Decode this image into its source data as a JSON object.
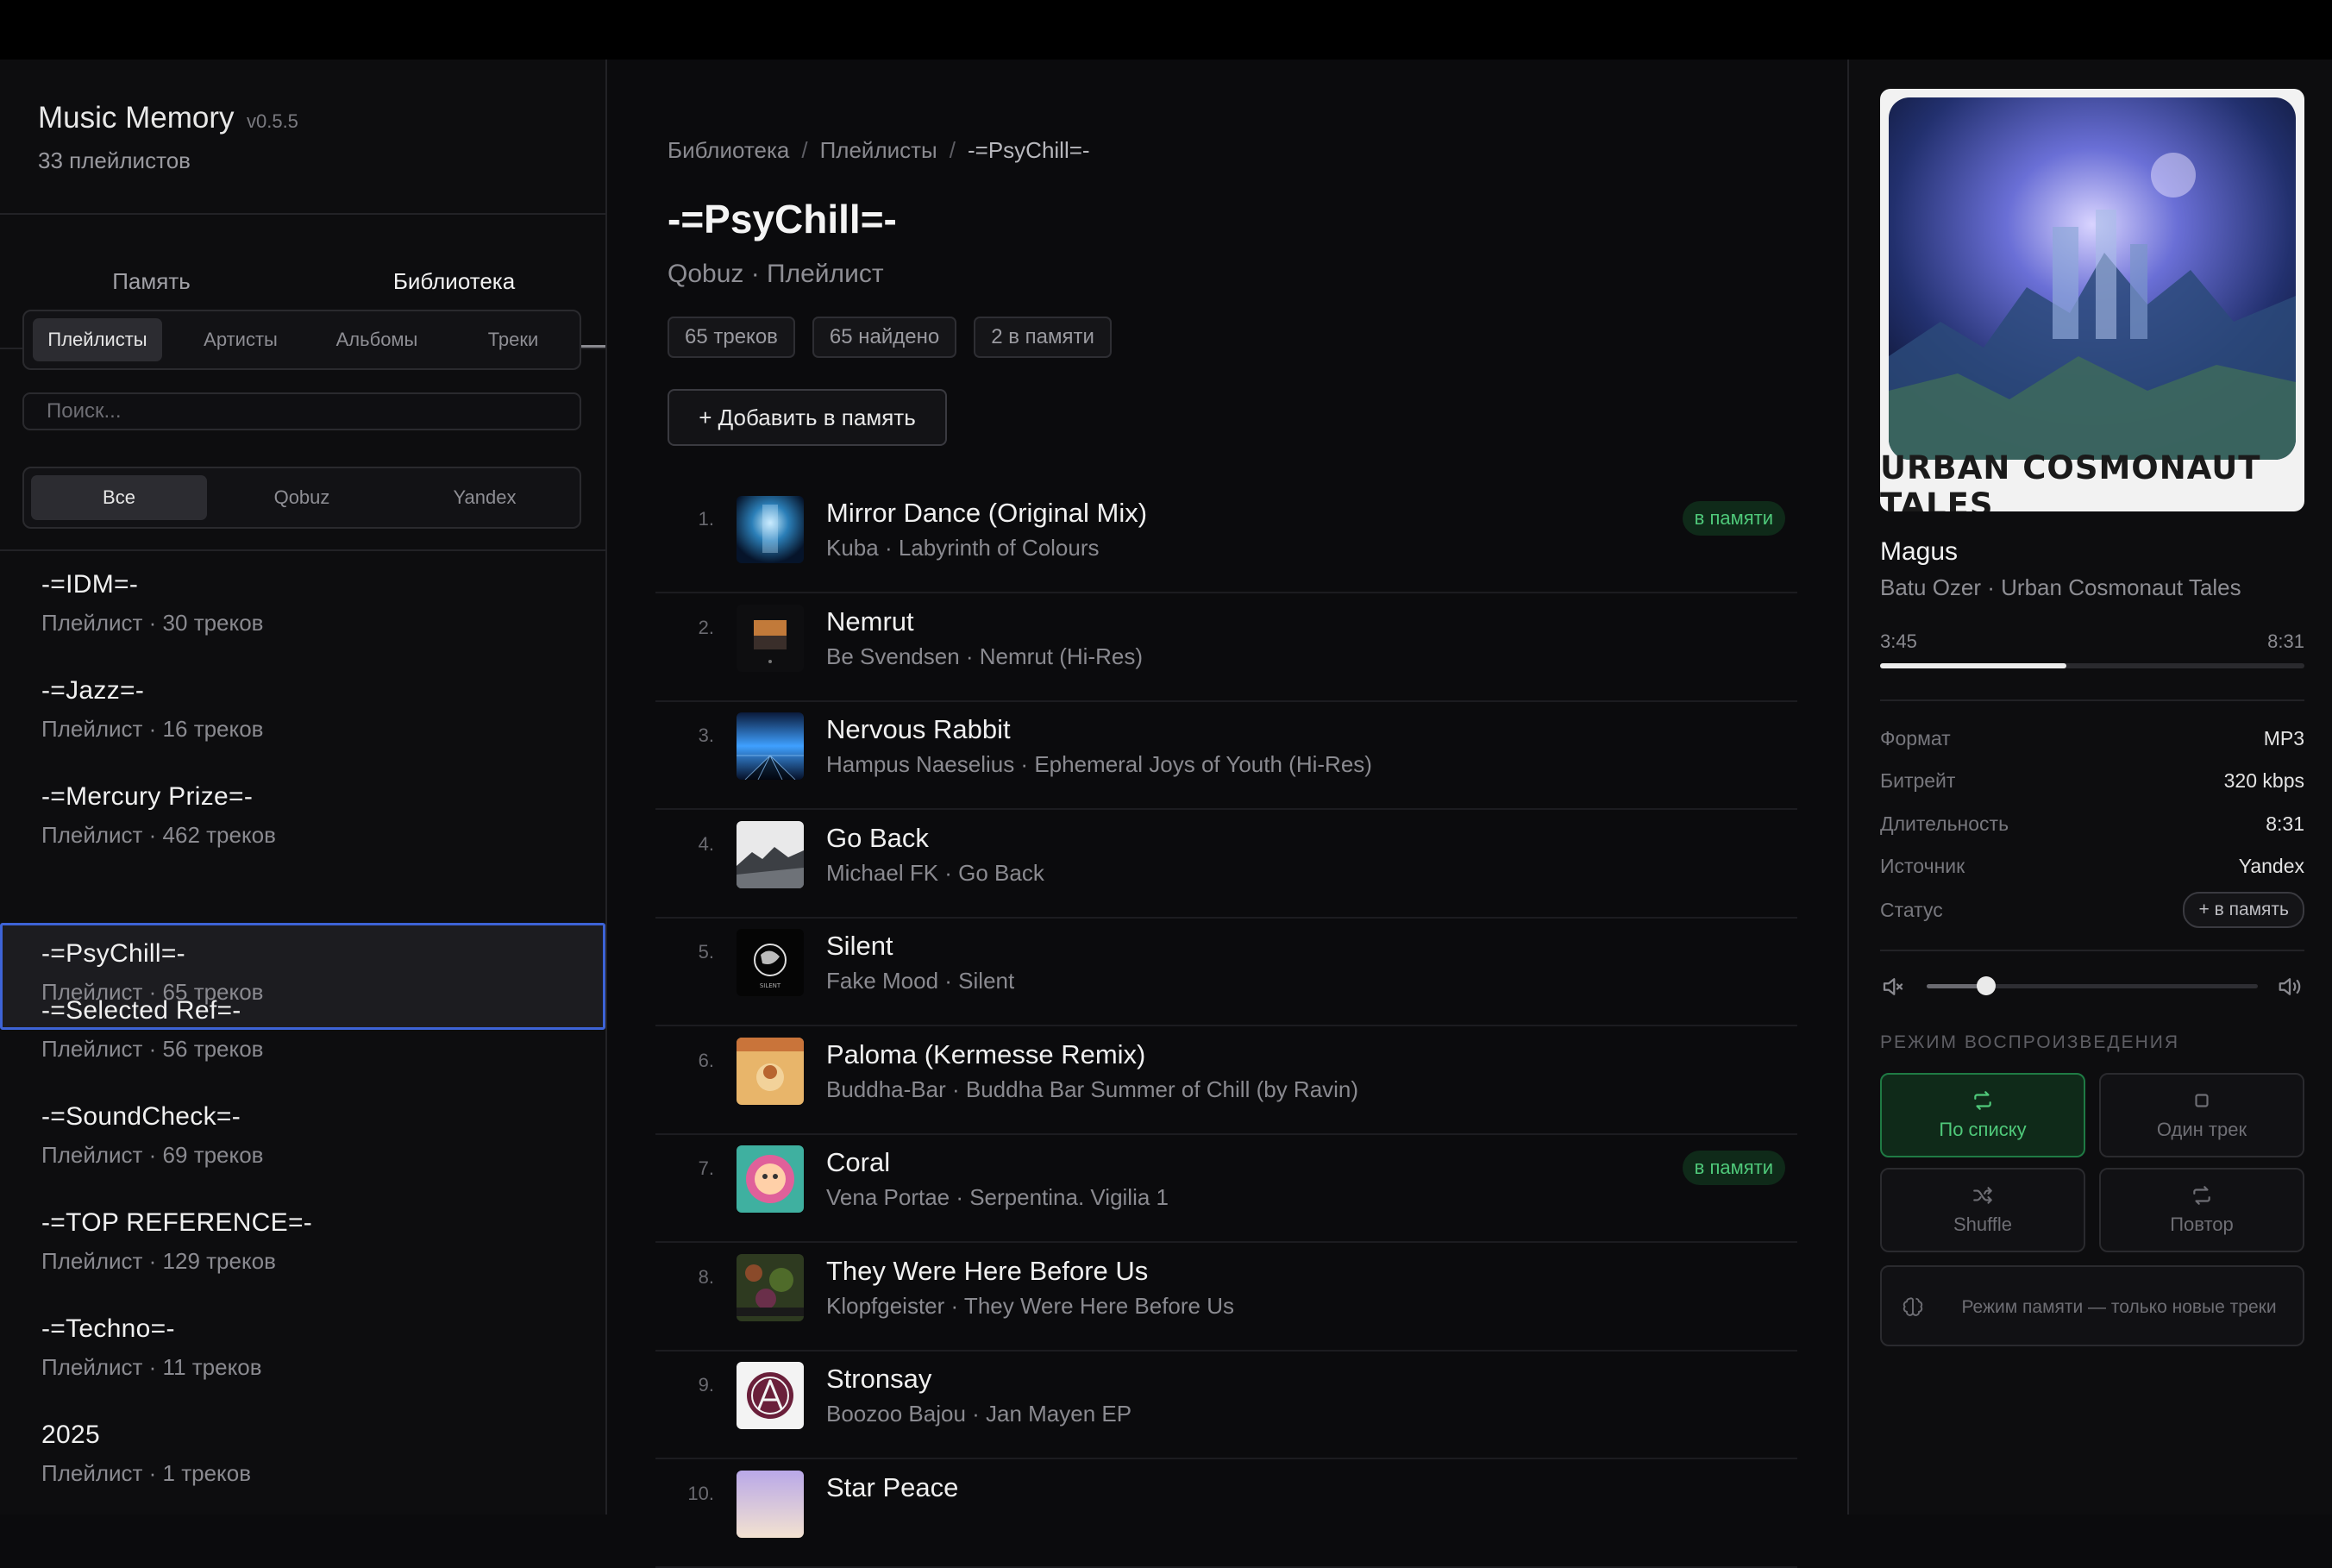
{
  "app": {
    "title": "Music Memory",
    "version": "v0.5.5",
    "playlists_count": "33 плейлистов"
  },
  "tabs": [
    {
      "label": "Память"
    },
    {
      "label": "Библиотека"
    }
  ],
  "library_filters": [
    {
      "label": "Плейлисты"
    },
    {
      "label": "Артисты"
    },
    {
      "label": "Альбомы"
    },
    {
      "label": "Треки"
    }
  ],
  "search": {
    "placeholder": "Поиск...",
    "value": ""
  },
  "source_filters": [
    {
      "label": "Все"
    },
    {
      "label": "Qobuz"
    },
    {
      "label": "Yandex"
    }
  ],
  "playlists": [
    {
      "name": "-=IDM=-",
      "meta": "Плейлист · 30 треков"
    },
    {
      "name": "-=Jazz=-",
      "meta": "Плейлист · 16 треков"
    },
    {
      "name": "-=Mercury Prize=-",
      "meta": "Плейлист · 462 треков"
    },
    {
      "name": "-=PsyChill=-",
      "meta": "Плейлист · 65 треков",
      "selected": true
    },
    {
      "name": "-=Selected Ref=-",
      "meta": "Плейлист · 56 треков"
    },
    {
      "name": "-=SoundCheck=-",
      "meta": "Плейлист · 69 треков"
    },
    {
      "name": "-=TOP REFERENCE=-",
      "meta": "Плейлист · 129 треков"
    },
    {
      "name": "-=Techno=-",
      "meta": "Плейлист · 11 треков"
    },
    {
      "name": "2025",
      "meta": "Плейлист · 1 треков"
    }
  ],
  "breadcrumbs": [
    "Библиотека",
    "Плейлисты",
    "-=PsyChill=-"
  ],
  "breadcrumb_separator": "/",
  "playlist": {
    "title": "-=PsyChill=-",
    "subtitle": "Qobuz · Плейлист",
    "stats": [
      "65 треков",
      "65 найдено",
      "2 в памяти"
    ],
    "add_button": "+ Добавить в память"
  },
  "memory_badge": "в памяти",
  "tracks": [
    {
      "num": "1.",
      "title": "Mirror Dance (Original Mix)",
      "meta": "Kuba · Labyrinth of Colours",
      "in_memory": true,
      "art": "art-1"
    },
    {
      "num": "2.",
      "title": "Nemrut",
      "meta": "Be Svendsen · Nemrut (Hi-Res)",
      "in_memory": false,
      "art": "art-2"
    },
    {
      "num": "3.",
      "title": "Nervous Rabbit",
      "meta": "Hampus Naeselius · Ephemeral Joys of Youth (Hi-Res)",
      "in_memory": false,
      "art": "art-3"
    },
    {
      "num": "4.",
      "title": "Go Back",
      "meta": "Michael FK · Go Back",
      "in_memory": false,
      "art": "art-4"
    },
    {
      "num": "5.",
      "title": "Silent",
      "meta": "Fake Mood · Silent",
      "in_memory": false,
      "art": "art-5"
    },
    {
      "num": "6.",
      "title": "Paloma (Kermesse Remix)",
      "meta": "Buddha-Bar · Buddha Bar Summer of Chill (by Ravin)",
      "in_memory": false,
      "art": "art-6"
    },
    {
      "num": "7.",
      "title": "Coral",
      "meta": "Vena Portae · Serpentina. Vigilia 1",
      "in_memory": true,
      "art": "art-7"
    },
    {
      "num": "8.",
      "title": "They Were Here Before Us",
      "meta": "Klopfgeister · They Were Here Before Us",
      "in_memory": false,
      "art": "art-8"
    },
    {
      "num": "9.",
      "title": "Stronsay",
      "meta": "Boozoo Bajou · Jan Mayen EP",
      "in_memory": false,
      "art": "art-9"
    },
    {
      "num": "10.",
      "title": "Star Peace",
      "meta": "",
      "in_memory": false,
      "art": "art-10"
    }
  ],
  "now_playing": {
    "cover_text": "URBAN COSMONAUT TALES",
    "title": "Magus",
    "meta": "Batu Ozer · Urban Cosmonaut Tales",
    "elapsed": "3:45",
    "total": "8:31",
    "progress": 0.44,
    "info": [
      {
        "label": "Формат",
        "value": "MP3"
      },
      {
        "label": "Битрейт",
        "value": "320 kbps"
      },
      {
        "label": "Длительность",
        "value": "8:31"
      },
      {
        "label": "Источник",
        "value": "Yandex"
      }
    ],
    "status_label": "Статус",
    "status_button": "+ в память",
    "volume": 0.18
  },
  "playback": {
    "title": "РЕЖИМ ВОСПРОИЗВЕДЕНИЯ",
    "modes": [
      {
        "label": "По списку",
        "icon": "repeat-icon",
        "active": true
      },
      {
        "label": "Один трек",
        "icon": "square-icon",
        "active": false
      },
      {
        "label": "Shuffle",
        "icon": "shuffle-icon",
        "active": false
      },
      {
        "label": "Повтор",
        "icon": "repeat-icon",
        "active": false
      }
    ],
    "memory_mode": "Режим памяти — только новые треки"
  },
  "colors": {
    "accent_green": "#4fc97a",
    "selected_border": "#3d63d6",
    "background": "#0b0b0d"
  }
}
